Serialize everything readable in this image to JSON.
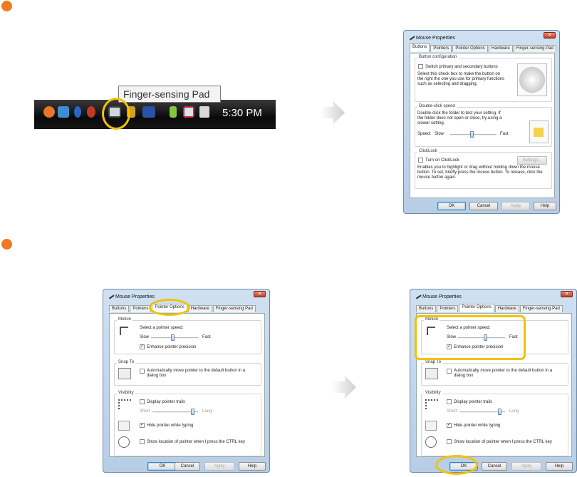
{
  "taskbar": {
    "clock": "5:30 PM",
    "tooltip": "Finger-sensing Pad"
  },
  "window": {
    "title": "Mouse Properties",
    "close": "✕"
  },
  "tabs": [
    "Buttons",
    "Pointers",
    "Pointer Options",
    "Hardware",
    "Finger-sensing Pad"
  ],
  "buttons_tab": {
    "button_config": "Button configuration",
    "switch_label": "Switch primary and secondary buttons",
    "switch_desc": "Select this check box to make the button on the right the one you use for primary functions such as selecting and dragging.",
    "double_click": "Double-click speed",
    "double_desc": "Double-click the folder to test your setting. If the folder does not open or close, try using a slower setting.",
    "speed": "Speed:",
    "slow": "Slow",
    "fast": "Fast",
    "clicklock": "ClickLock",
    "turn_on": "Turn on ClickLock",
    "settings": "Settings...",
    "clicklock_desc": "Enables you to highlight or drag without holding down the mouse button. To set, briefly press the mouse button. To release, click the mouse button again."
  },
  "pointer_options": {
    "motion": "Motion",
    "select_speed": "Select a pointer speed:",
    "slow": "Slow",
    "fast": "Fast",
    "enhance": "Enhance pointer precision",
    "snap_to": "Snap To",
    "auto_move": "Automatically move pointer to the default button in a dialog box",
    "visibility": "Visibility",
    "trails": "Display pointer trails",
    "short": "Short",
    "long": "Long",
    "hide": "Hide pointer while typing",
    "show_loc": "Show location of pointer when I press the CTRL key"
  },
  "dialog_buttons": {
    "ok": "OK",
    "cancel": "Cancel",
    "apply": "Apply",
    "help": "Help"
  },
  "colors": {
    "step_dot": "#f07a20",
    "highlight": "#f2c200"
  }
}
